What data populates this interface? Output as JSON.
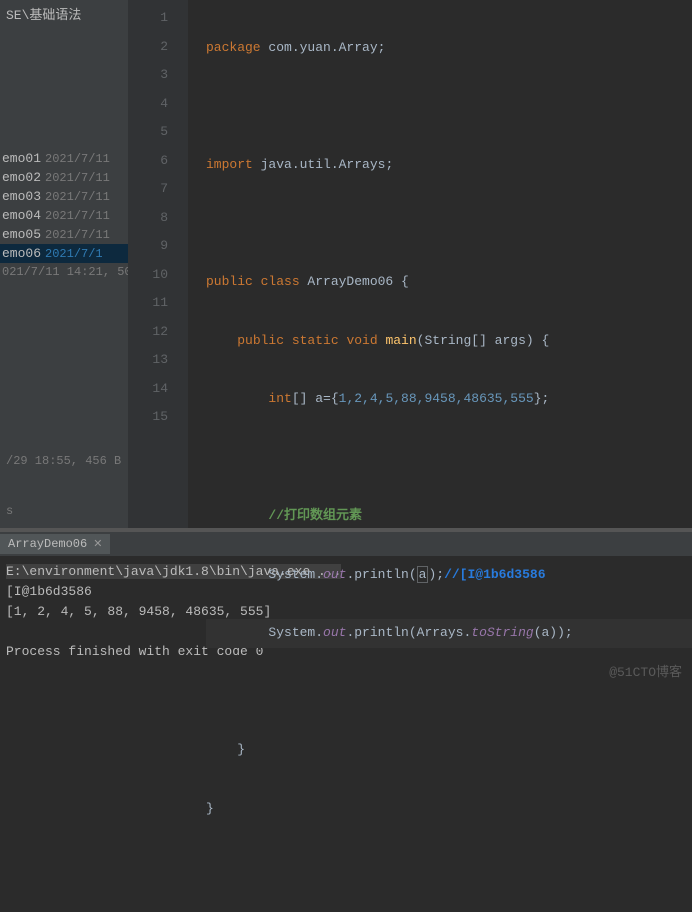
{
  "sidebar": {
    "header": "SE\\基础语法",
    "files": [
      {
        "name": "emo01",
        "date": "2021/7/11"
      },
      {
        "name": "emo02",
        "date": "2021/7/11"
      },
      {
        "name": "emo03",
        "date": "2021/7/11"
      },
      {
        "name": "emo04",
        "date": "2021/7/11"
      },
      {
        "name": "emo05",
        "date": "2021/7/11"
      },
      {
        "name": "emo06",
        "date": "2021/7/1"
      }
    ],
    "selected_index": 5,
    "subdate": "021/7/11 14:21, 50",
    "info1": "/29 18:55, 456 B",
    "info2": "s"
  },
  "editor": {
    "lines": [
      "1",
      "2",
      "3",
      "4",
      "5",
      "6",
      "7",
      "8",
      "9",
      "10",
      "11",
      "12",
      "13",
      "14",
      "15"
    ],
    "run_icons_at": [
      5,
      6
    ],
    "fold_icons_at": [
      5,
      11,
      13
    ],
    "highlight_line": 11,
    "code": {
      "l1": {
        "kw1": "package ",
        "pkg": "com.yuan.Array",
        "end": ";"
      },
      "l3": {
        "kw1": "import ",
        "pkg": "java.util.Arrays",
        "end": ";"
      },
      "l5": {
        "kw1": "public class ",
        "cls": "ArrayDemo06 ",
        "brace": "{"
      },
      "l6": {
        "indent": "    ",
        "kw1": "public static ",
        "kw2": "void ",
        "mth": "main",
        "args": "(String[] args) {"
      },
      "l7": {
        "indent": "        ",
        "kw1": "int",
        "arr": "[] a={",
        "nums": "1,2,4,5,88,9458,48635,555",
        "end": "};"
      },
      "l9": {
        "indent": "        ",
        "cmt": "//打印数组元素"
      },
      "l10": {
        "indent": "        ",
        "sys": "System.",
        "out": "out",
        "dot": ".println(",
        "arg": "a",
        "close": ");",
        "inline": "//[I@1b6d3586"
      },
      "l11": {
        "indent": "        ",
        "sys": "System.",
        "out": "out",
        "dot": ".println(Arrays.",
        "ts": "toString",
        "close": "(a));"
      },
      "l13": {
        "indent": "    ",
        "brace": "}"
      },
      "l14": {
        "brace": "}"
      }
    }
  },
  "terminal": {
    "tab": "ArrayDemo06",
    "cmd": "E:\\environment\\java\\jdk1.8\\bin\\java.exe ...",
    "out1": "[I@1b6d3586",
    "out2": "[1, 2, 4, 5, 88, 9458, 48635, 555]",
    "out3": "Process finished with exit code 0"
  },
  "watermark": "@51CTO博客"
}
